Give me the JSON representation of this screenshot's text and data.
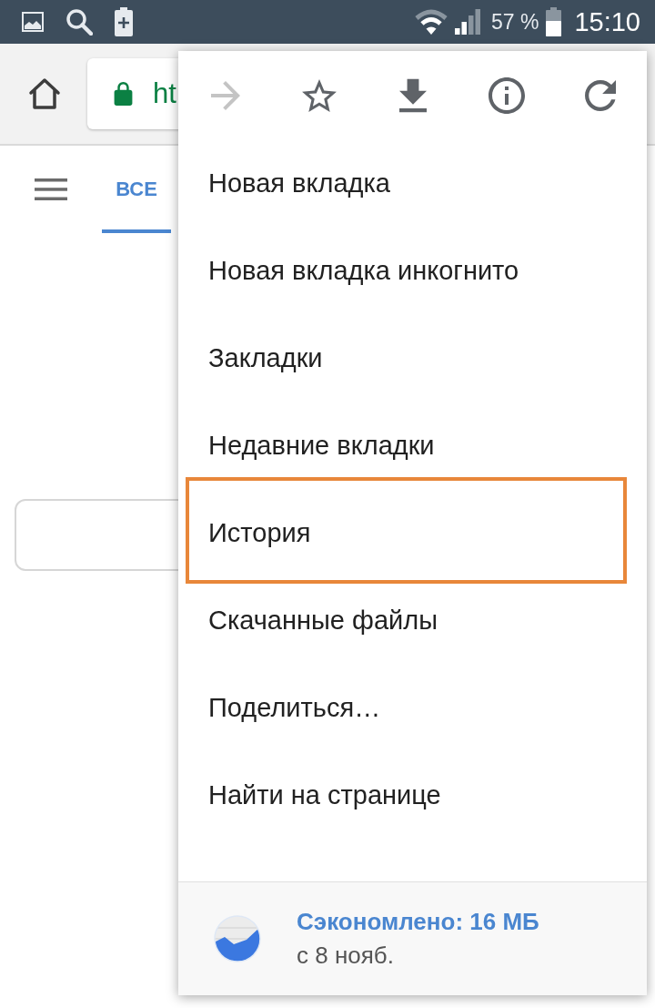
{
  "status_bar": {
    "battery_text": "57 %",
    "time": "15:10"
  },
  "toolbar": {
    "url_field": {
      "value": "ht"
    }
  },
  "page": {
    "tabs": [
      {
        "label": "ВСЕ",
        "selected": true
      }
    ]
  },
  "menu": {
    "actions": [
      {
        "kind": "forward",
        "disabled": true
      },
      {
        "kind": "bookmark",
        "disabled": false
      },
      {
        "kind": "download",
        "disabled": false
      },
      {
        "kind": "info",
        "disabled": false
      },
      {
        "kind": "reload",
        "disabled": false
      }
    ],
    "items": [
      {
        "label": "Новая вкладка",
        "highlighted": false
      },
      {
        "label": "Новая вкладка инкогнито",
        "highlighted": false
      },
      {
        "label": "Закладки",
        "highlighted": false
      },
      {
        "label": "Недавние вкладки",
        "highlighted": false
      },
      {
        "label": "История",
        "highlighted": true
      },
      {
        "label": "Скачанные файлы",
        "highlighted": false
      },
      {
        "label": "Поделиться…",
        "highlighted": false
      },
      {
        "label": "Найти на странице",
        "highlighted": false
      }
    ],
    "footer": {
      "title": "Сэкономлено: 16 МБ",
      "subtitle": "с 8 нояб."
    }
  }
}
